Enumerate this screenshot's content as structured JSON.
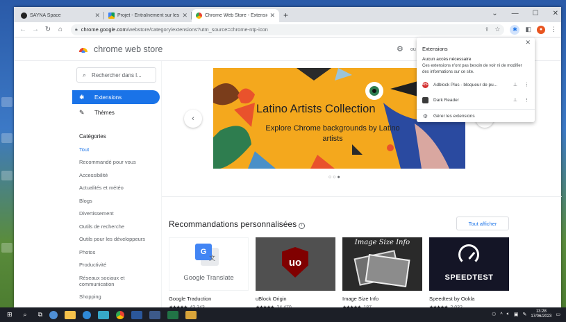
{
  "colors": {
    "accent": "#1a73e8",
    "banner_bg": "#f4a81d",
    "taskbar": "#1c1f27"
  },
  "tabs": [
    {
      "title": "SAYNA Space",
      "icon": "sayna-favicon",
      "active": false
    },
    {
      "title": "Projet - Entraînement sur les ba...",
      "icon": "drive-favicon",
      "active": false
    },
    {
      "title": "Chrome Web Store - Extensions",
      "icon": "chrome-web-store-favicon",
      "active": true
    }
  ],
  "omnibox": {
    "domain": "chrome.google.com",
    "path": "/webstore/category/extensions?utm_source=chrome-ntp-icon"
  },
  "store": {
    "title": "chrome web store",
    "settings_partial": "ou"
  },
  "sidebar": {
    "search_placeholder": "Rechercher dans l...",
    "extensions_label": "Extensions",
    "themes_label": "Thèmes",
    "categories_title": "Catégories",
    "categories": [
      "Tout",
      "Recommandé pour vous",
      "Accessibilité",
      "Actualités et météo",
      "Blogs",
      "Divertissement",
      "Outils de recherche",
      "Outils pour les développeurs",
      "Photos",
      "Productivité",
      "Réseaux sociaux et communication",
      "Shopping"
    ]
  },
  "banner": {
    "title": "Latino Artists Collection",
    "subtitle": "Explore Chrome backgrounds by Latino artists"
  },
  "recommendations": {
    "title": "Recommandations personnalisées",
    "see_all": "Tout afficher",
    "cards": [
      {
        "name": "Google Traduction",
        "thumb_label": "Google Translate",
        "count": "43 343"
      },
      {
        "name": "uBlock Origin",
        "thumb_label": "",
        "count": "24 470"
      },
      {
        "name": "Image Size Info",
        "thumb_label": "Image Size Info",
        "count": "187"
      },
      {
        "name": "Speedtest by Ookla",
        "thumb_label": "SPEEDTEST",
        "count": "2 032"
      }
    ]
  },
  "extensions_popup": {
    "title": "Extensions",
    "section": "Aucun accès nécessaire",
    "description": "Ces extensions n'ont pas besoin de voir ni de modifier des informations sur ce site.",
    "items": [
      {
        "name": "Adblock Plus - bloqueur de pu...",
        "icon": "adblock-plus-icon"
      },
      {
        "name": "Dark Reader",
        "icon": "dark-reader-icon"
      }
    ],
    "manage": "Gérer les extensions"
  },
  "taskbar": {
    "time": "13:28",
    "date": "17/06/2023"
  }
}
